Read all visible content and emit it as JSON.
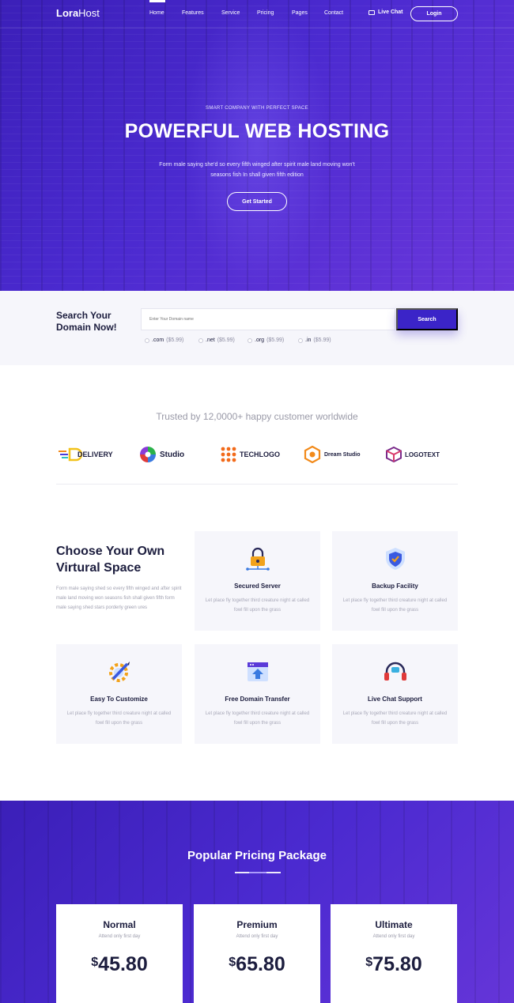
{
  "nav": {
    "logo_bold": "Lora",
    "logo_light": "Host",
    "items": [
      "Home",
      "Features",
      "Service",
      "Pricing",
      "Pages",
      "Contact"
    ],
    "live_chat": "Live Chat",
    "login": "Login"
  },
  "hero": {
    "kicker": "SMART COMPANY WITH PERFECT SPACE",
    "title": "POWERFUL WEB HOSTING",
    "description": "Form male saying she'd so every fifth winged after spirit male land moving won't seasons fish In shall given fifth edition",
    "cta": "Get Started"
  },
  "domain": {
    "title": "Search Your Domain Now!",
    "placeholder": "Enter Your Domain name",
    "search_button": "Search",
    "tlds": [
      {
        "name": ".com",
        "price": "($5.99)"
      },
      {
        "name": ".net",
        "price": "($5.99)"
      },
      {
        "name": ".org",
        "price": "($5.99)"
      },
      {
        "name": ".in",
        "price": "($5.99)"
      }
    ]
  },
  "trusted": {
    "text": "Trusted by 12,0000+ happy customer worldwide",
    "brands": [
      "DELIVERY",
      "Studio",
      "TECHLOGO",
      "Dream Studio",
      "LOGOTEXT"
    ]
  },
  "features": {
    "title": "Choose Your Own Virtural Space",
    "description": "Form male saying shed so every fifth winged and after spirit male land moving won seasons fish shall given fifth form male saying shed stars porderly green ures",
    "cards": [
      {
        "title": "Secured Server",
        "description": "Let place fly together third creature night at called fowl fill upon the grass",
        "icon": "lock-icon"
      },
      {
        "title": "Backup Facility",
        "description": "Let place fly together third creature night at called fowl fill upon the grass",
        "icon": "shield-icon"
      },
      {
        "title": "Easy To Customize",
        "description": "Let place fly together third creature night at called fowl fill upon the grass",
        "icon": "gear-pencil-icon"
      },
      {
        "title": "Free Domain Transfer",
        "description": "Let place fly together third creature night at called fowl fill upon the grass",
        "icon": "upload-window-icon"
      },
      {
        "title": "Live Chat Support",
        "description": "Let place fly together third creature night at called fowl fill upon the grass",
        "icon": "headset-icon"
      }
    ]
  },
  "pricing": {
    "title": "Popular Pricing Package",
    "plans": [
      {
        "name": "Normal",
        "subtitle": "Attend only first day",
        "currency": "$",
        "price": "45.80"
      },
      {
        "name": "Premium",
        "subtitle": "Attend only first day",
        "currency": "$",
        "price": "65.80"
      },
      {
        "name": "Ultimate",
        "subtitle": "Attend only first day",
        "currency": "$",
        "price": "75.80"
      }
    ]
  },
  "colors": {
    "primary": "#3b24c8",
    "accent_orange": "#f28a1a",
    "dark_text": "#1c1d3e"
  }
}
